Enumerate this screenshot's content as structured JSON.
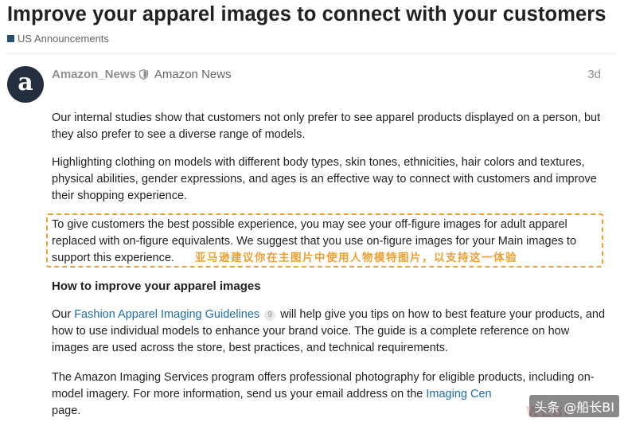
{
  "topic": {
    "title": "Improve your apparel images to connect with your customers",
    "category": "US Announcements",
    "category_color": "#25506d"
  },
  "post": {
    "avatar_letter": "a",
    "username": "Amazon_News",
    "full_name": "Amazon News",
    "time_ago": "3d",
    "p1": "Our internal studies show that customers not only prefer to see apparel products displayed on a person, but they also prefer to see a diverse range of models.",
    "p2": "Highlighting clothing on models with different body types, skin tones, ethnicities, hair colors and textures, physical abilities, gender expressions, and ages is an effective way to connect with customers and improve their shopping experience.",
    "p3": "To give customers the best possible experience, you may see your off-figure images for adult apparel replaced with on-figure equivalents. We suggest that you use on-figure images for your Main images to support this experience.",
    "p3_annotation": "亚马逊建议你在主图片中使用人物模特图片，以支持这一体验",
    "heading": "How to improve your apparel images",
    "p4_before": "Our ",
    "p4_link": "Fashion Apparel Imaging Guidelines",
    "p4_link_count": "9",
    "p4_after": " will help give you tips on how to best feature your products, and how to use individual models to enhance your brand voice. The guide is a complete reference on how images are used across the store, best practices, and technical requirements.",
    "p5_before": "The Amazon Imaging Services program offers professional photography for eligible products, including on-model imagery. For more information, send us your email address on the ",
    "p5_link": "Imaging Cen",
    "p5_after": "page."
  },
  "watermark": {
    "text": "头条 @船长BI",
    "faded": "WEBI"
  },
  "colors": {
    "link": "#1f6ea8",
    "highlight_border": "#f0a030",
    "avatar_bg": "#232f3e"
  },
  "icons": {
    "staff": "shield-icon"
  }
}
